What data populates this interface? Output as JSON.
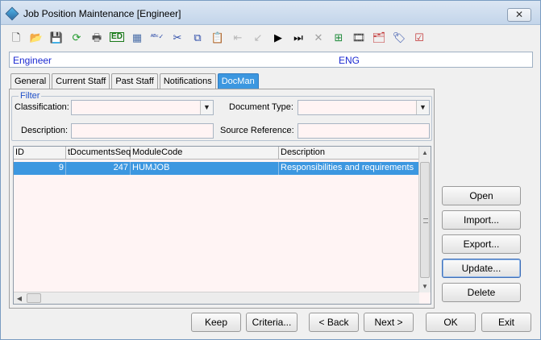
{
  "window": {
    "title": "Job Position Maintenance  [Engineer]",
    "close_glyph": "✕"
  },
  "toolbar": {
    "buttons": [
      {
        "name": "new-icon",
        "glyph": "🗋",
        "color": "#3a3a3a"
      },
      {
        "name": "open-folder-icon",
        "glyph": "📂",
        "color": "#d8a21c"
      },
      {
        "name": "save-icon",
        "glyph": "💾",
        "color": "#9a9a9a"
      },
      {
        "name": "refresh-icon",
        "glyph": "⟳",
        "color": "#1e9a2a"
      },
      {
        "name": "print-icon",
        "glyph": "🖶",
        "color": "#555555"
      },
      {
        "name": "edit-icon",
        "glyph": "ED",
        "color": "#1a7a1a"
      },
      {
        "name": "calculator-icon",
        "glyph": "▦",
        "color": "#4a6ea8"
      },
      {
        "name": "spellcheck-icon",
        "glyph": "ᴬᴮᶜ✓",
        "color": "#2a4aa8"
      },
      {
        "name": "cut-icon",
        "glyph": "✂",
        "color": "#2a4aa8"
      },
      {
        "name": "copy-icon",
        "glyph": "⧉",
        "color": "#2a4aa8"
      },
      {
        "name": "paste-icon",
        "glyph": "📋",
        "color": "#b8860b"
      },
      {
        "name": "first-record-icon",
        "glyph": "⇤",
        "color": "#b8b8b8"
      },
      {
        "name": "previous-record-icon",
        "glyph": "↙",
        "color": "#b8b8b8"
      },
      {
        "name": "next-record-icon",
        "glyph": "▶",
        "color": "#000000"
      },
      {
        "name": "last-record-icon",
        "glyph": "⏭",
        "color": "#000000"
      },
      {
        "name": "delete-icon",
        "glyph": "✕",
        "color": "#a0a0a0"
      },
      {
        "name": "grid-settings-icon",
        "glyph": "⊞",
        "color": "#1e8a3a"
      },
      {
        "name": "film-icon",
        "glyph": "🎞",
        "color": "#333333"
      },
      {
        "name": "report-icon",
        "glyph": "🗂",
        "color": "#c03030"
      },
      {
        "name": "tag-icon",
        "glyph": "🏷",
        "color": "#2a4aa8"
      },
      {
        "name": "checklist-icon",
        "glyph": "☑",
        "color": "#c03030"
      }
    ]
  },
  "header": {
    "position_name": "Engineer",
    "position_code": "ENG"
  },
  "tabs": [
    {
      "label": "General",
      "active": false
    },
    {
      "label": "Current Staff",
      "active": false
    },
    {
      "label": "Past Staff",
      "active": false
    },
    {
      "label": "Notifications",
      "active": false
    },
    {
      "label": "DocMan",
      "active": true
    }
  ],
  "filter": {
    "legend": "Filter",
    "classification_label": "Classification:",
    "classification_value": "",
    "document_type_label": "Document Type:",
    "document_type_value": "",
    "description_label": "Description:",
    "description_value": "",
    "source_reference_label": "Source Reference:",
    "source_reference_value": ""
  },
  "grid": {
    "columns": [
      "ID",
      "tDocumentsSeq",
      "ModuleCode",
      "Description"
    ],
    "rows": [
      {
        "id": "9",
        "seq": "247",
        "module": "HUMJOB",
        "description": "Responsibilities and requirements",
        "selected": true
      }
    ]
  },
  "side_buttons": {
    "open": "Open",
    "import": "Import...",
    "export": "Export...",
    "update": "Update...",
    "delete": "Delete"
  },
  "bottom_buttons": {
    "keep": "Keep",
    "criteria": "Criteria...",
    "back": "< Back",
    "next": "Next >",
    "ok": "OK",
    "exit": "Exit"
  },
  "colors": {
    "accent_blue": "#3c97e0",
    "header_text": "#1c2ad2",
    "input_background": "#fff4f4"
  }
}
